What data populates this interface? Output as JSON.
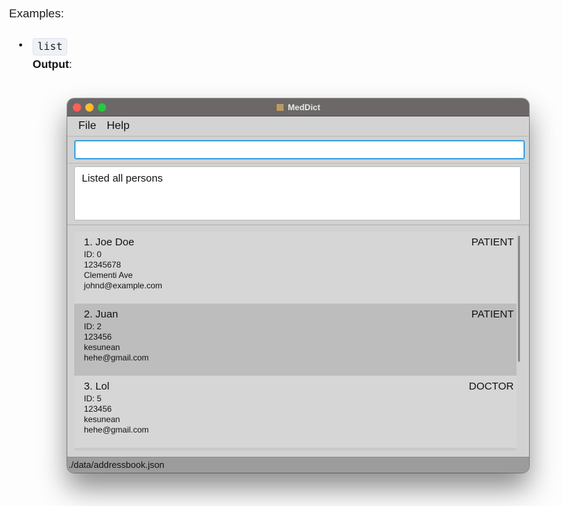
{
  "doc": {
    "examples_heading": "Examples:",
    "bullet": "•",
    "code": "list",
    "output_label": "Output",
    "output_suffix": ":"
  },
  "window": {
    "title": "MedDict",
    "menu": [
      "File",
      "Help"
    ],
    "command_input": {
      "value": "",
      "placeholder": ""
    },
    "result_text": "Listed all persons",
    "persons": [
      {
        "index_name": "1. Joe Doe",
        "role": "PATIENT",
        "id": "ID: 0",
        "phone": "12345678",
        "address": "Clementi Ave",
        "email": "johnd@example.com"
      },
      {
        "index_name": "2. Juan",
        "role": "PATIENT",
        "id": "ID: 2",
        "phone": "123456",
        "address": "kesunean",
        "email": "hehe@gmail.com"
      },
      {
        "index_name": "3. Lol",
        "role": "DOCTOR",
        "id": "ID: 5",
        "phone": "123456",
        "address": "kesunean",
        "email": "hehe@gmail.com"
      }
    ],
    "status_path": "./data/addressbook.json"
  },
  "colors": {
    "titlebar": "#6b6867",
    "input_focus": "#3ea3e0",
    "close": "#ff5f57",
    "minimize": "#febc2e",
    "zoom": "#28c840"
  }
}
